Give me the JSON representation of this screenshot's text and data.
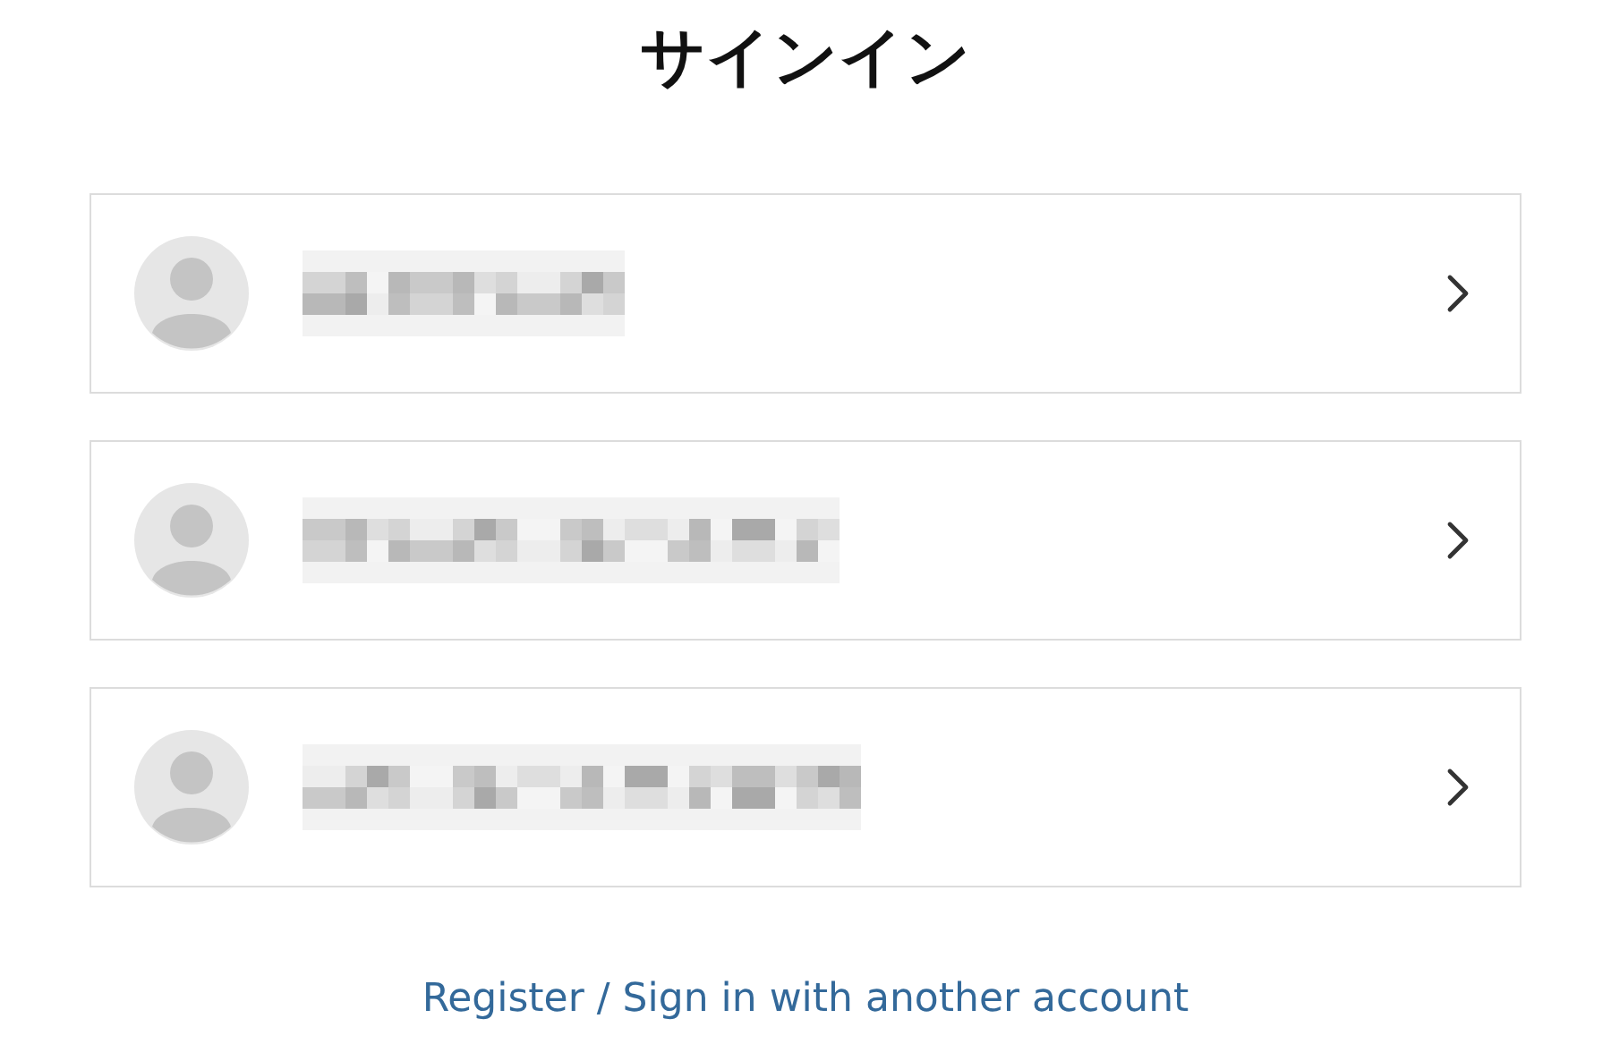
{
  "title": "サインイン",
  "accounts": [
    {
      "kind": "redacted"
    },
    {
      "kind": "redacted"
    },
    {
      "kind": "redacted"
    }
  ],
  "link": "Register / Sign in with another account"
}
